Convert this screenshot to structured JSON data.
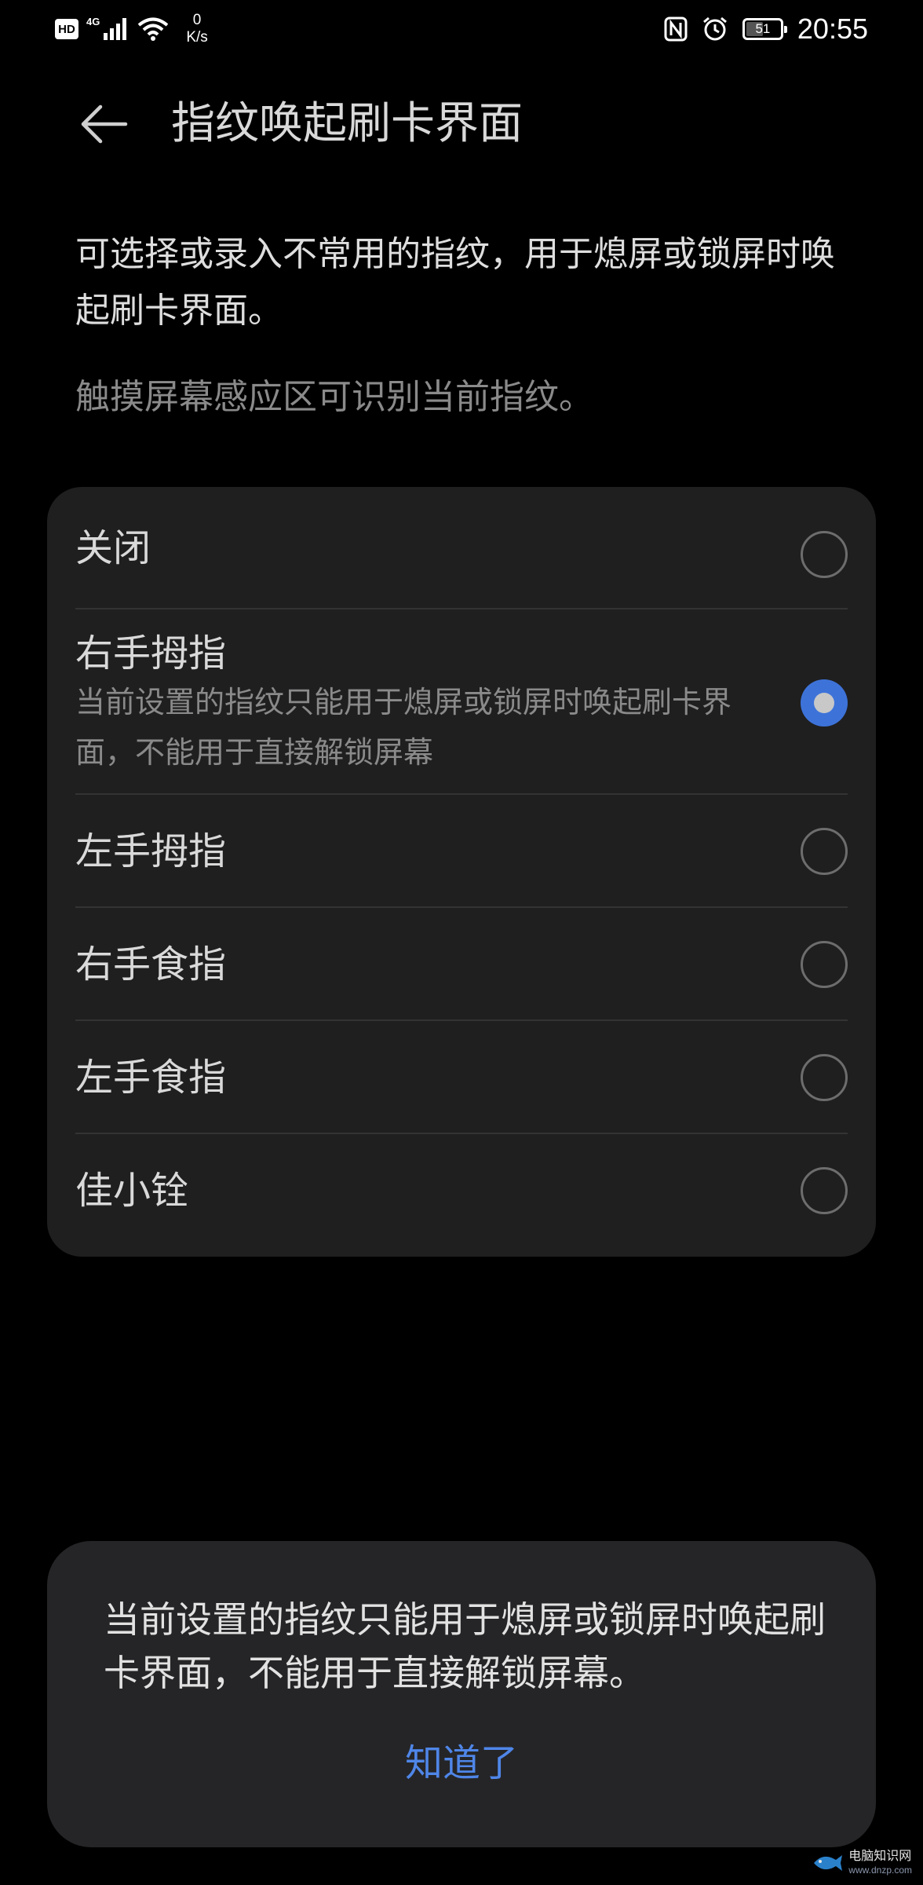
{
  "status_bar": {
    "hd": "HD",
    "network_type": "4G",
    "speed_value": "0",
    "speed_unit": "K/s",
    "battery": "51",
    "battery_level": 0.51,
    "time": "20:55",
    "icons": [
      "hd-icon",
      "signal-icon",
      "wifi-icon",
      "nfc-icon",
      "alarm-icon",
      "battery-icon"
    ]
  },
  "header": {
    "title": "指纹唤起刷卡界面",
    "back_icon": "arrow-left-icon"
  },
  "description": "可选择或录入不常用的指纹，用于熄屏或锁屏时唤起刷卡界面。",
  "hint": "触摸屏幕感应区可识别当前指纹。",
  "options": [
    {
      "label": "关闭",
      "selected": false
    },
    {
      "label": "右手拇指",
      "sub": "当前设置的指纹只能用于熄屏或锁屏时唤起刷卡界面，不能用于直接解锁屏幕",
      "selected": true
    },
    {
      "label": "左手拇指",
      "selected": false
    },
    {
      "label": "右手食指",
      "selected": false
    },
    {
      "label": "左手食指",
      "selected": false
    },
    {
      "label": "佳小铨",
      "selected": false
    }
  ],
  "dialog": {
    "message": "当前设置的指纹只能用于熄屏或锁屏时唤起刷卡界面，不能用于直接解锁屏幕。",
    "button": "知道了"
  },
  "watermark": {
    "text": "电脑知识网",
    "sub": "www.dnzp.com"
  },
  "colors": {
    "background": "#000000",
    "card": "#1f1f20",
    "dialog": "#252527",
    "accent": "#3d73d9",
    "button_text": "#4f86e8"
  }
}
